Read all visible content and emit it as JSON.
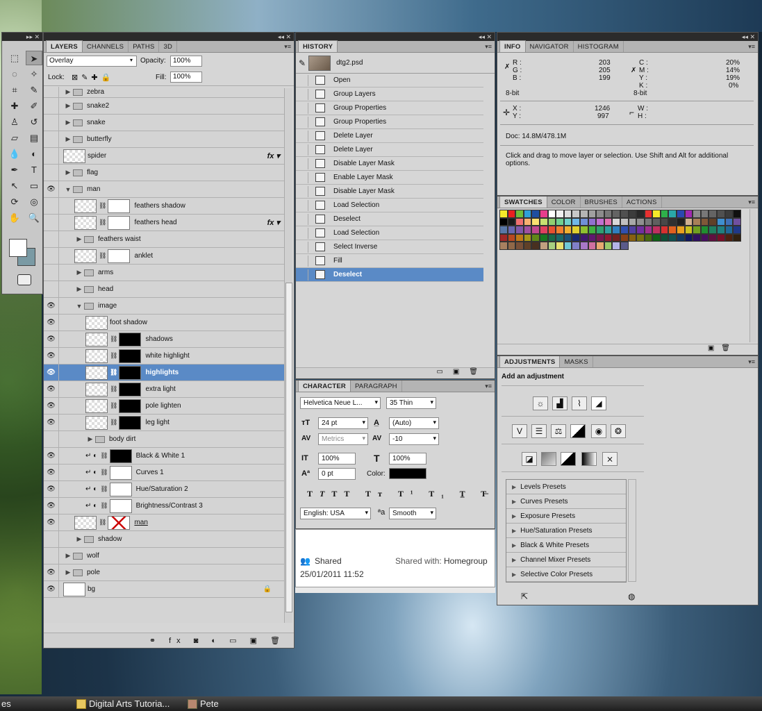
{
  "layers": {
    "tabs": [
      "LAYERS",
      "CHANNELS",
      "PATHS",
      "3D"
    ],
    "blend_mode": "Overlay",
    "opacity_label": "Opacity:",
    "opacity": "100%",
    "lock_label": "Lock:",
    "fill_label": "Fill:",
    "fill": "100%",
    "rows": [
      {
        "name": "zebra",
        "type": "group"
      },
      {
        "name": "snake2",
        "type": "group"
      },
      {
        "name": "snake",
        "type": "group"
      },
      {
        "name": "butterfly",
        "type": "group"
      },
      {
        "name": "spider",
        "type": "layer",
        "fx": "fx"
      },
      {
        "name": "flag",
        "type": "group"
      },
      {
        "name": "man",
        "type": "group-open",
        "eye": true
      },
      {
        "name": "feathers shadow",
        "type": "masked",
        "indent": 1
      },
      {
        "name": "feathers head",
        "type": "masked",
        "indent": 1,
        "fx": "fx"
      },
      {
        "name": "feathers waist",
        "type": "group",
        "indent": 1
      },
      {
        "name": "anklet",
        "type": "masked",
        "indent": 1
      },
      {
        "name": "arms",
        "type": "group",
        "indent": 1
      },
      {
        "name": "head",
        "type": "group",
        "indent": 1
      },
      {
        "name": "image",
        "type": "group-open",
        "indent": 1,
        "eye": true
      },
      {
        "name": "foot shadow",
        "type": "layer",
        "indent": 2,
        "eye": true
      },
      {
        "name": "shadows",
        "type": "masked-black",
        "indent": 2,
        "eye": true
      },
      {
        "name": "white highlight",
        "type": "masked-black",
        "indent": 2,
        "eye": true
      },
      {
        "name": "highlights",
        "type": "masked-black",
        "indent": 2,
        "eye": true,
        "selected": true
      },
      {
        "name": "extra light",
        "type": "masked-black",
        "indent": 2,
        "eye": true
      },
      {
        "name": "pole lighten",
        "type": "masked-black",
        "indent": 2,
        "eye": true
      },
      {
        "name": "leg light",
        "type": "masked-black",
        "indent": 2,
        "eye": true
      },
      {
        "name": "body dirt",
        "type": "group",
        "indent": 2
      },
      {
        "name": "Black & White 1",
        "type": "adjust",
        "indent": 2,
        "eye": true,
        "black": true
      },
      {
        "name": "Curves 1",
        "type": "adjust",
        "indent": 2,
        "eye": true
      },
      {
        "name": "Hue/Saturation 2",
        "type": "adjust",
        "indent": 2,
        "eye": true
      },
      {
        "name": "Brightness/Contrast 3",
        "type": "adjust",
        "indent": 2,
        "eye": true
      },
      {
        "name": "man",
        "type": "smart",
        "indent": 1,
        "eye": true
      },
      {
        "name": "shadow",
        "type": "group",
        "indent": 1
      },
      {
        "name": "wolf",
        "type": "group"
      },
      {
        "name": "pole",
        "type": "group",
        "eye": true
      },
      {
        "name": "bg",
        "type": "bg",
        "eye": true
      }
    ]
  },
  "history": {
    "tab": "HISTORY",
    "snapshot": "dtg2.psd",
    "steps": [
      "Open",
      "Group Layers",
      "Group Properties",
      "Group Properties",
      "Delete Layer",
      "Delete Layer",
      "Disable Layer Mask",
      "Enable Layer Mask",
      "Disable Layer Mask",
      "Load Selection",
      "Deselect",
      "Load Selection",
      "Select Inverse",
      "Fill",
      "Deselect"
    ],
    "selected_index": 14
  },
  "character": {
    "tabs": [
      "CHARACTER",
      "PARAGRAPH"
    ],
    "font_family": "Helvetica Neue L...",
    "font_style": "35 Thin",
    "size": "24 pt",
    "leading": "(Auto)",
    "kerning": "Metrics",
    "tracking": "-10",
    "vscale": "100%",
    "hscale": "100%",
    "baseline": "0 pt",
    "color_label": "Color:",
    "language": "English: USA",
    "aa_label": "a",
    "antialias": "Smooth"
  },
  "explorer": {
    "shared": "Shared",
    "shared_with_label": "Shared with:",
    "shared_with": "Homegroup",
    "date": "25/01/2011 11:52"
  },
  "info": {
    "tabs": [
      "INFO",
      "NAVIGATOR",
      "HISTOGRAM"
    ],
    "r_label": "R :",
    "r": "203",
    "g_label": "G :",
    "g": "205",
    "b_label": "B :",
    "b": "199",
    "c_label": "C :",
    "c": "20%",
    "m_label": "M :",
    "m": "14%",
    "y_label": "Y :",
    "y": "19%",
    "k_label": "K :",
    "k": "0%",
    "bit_left": "8-bit",
    "bit_right": "8-bit",
    "x_label": "X :",
    "x": "1246",
    "y2_label": "Y :",
    "y2": "997",
    "w_label": "W :",
    "h_label": "H :",
    "doc": "Doc: 14.8M/478.1M",
    "hint": "Click and drag to move layer or selection.  Use Shift and Alt for additional options."
  },
  "swatches": {
    "tabs": [
      "SWATCHES",
      "COLOR",
      "BRUSHES",
      "ACTIONS"
    ],
    "colors": [
      "#f5e92a",
      "#ea2020",
      "#6fbd3a",
      "#2ea0d8",
      "#1e4fa0",
      "#e83d8c",
      "#ffffff",
      "#f0f0f0",
      "#dcdcdc",
      "#c8c8c8",
      "#b4b4b4",
      "#a0a0a0",
      "#8c8c8c",
      "#787878",
      "#646464",
      "#505050",
      "#3c3c3c",
      "#282828",
      "#e83030",
      "#f5e92a",
      "#2eb04a",
      "#2aa8a8",
      "#2a48b0",
      "#a02ab0",
      "#8c8c8c",
      "#787878",
      "#646464",
      "#505050",
      "#3c3c3c",
      "#101010",
      "#000000",
      "#1a1a1a",
      "#f07070",
      "#f8b070",
      "#f8e070",
      "#c8e070",
      "#90d070",
      "#70d090",
      "#70d0c8",
      "#70b8e8",
      "#7090d8",
      "#9070d0",
      "#c070d0",
      "#e070b0",
      "#d8d8d8",
      "#c0c0c0",
      "#a8a8a8",
      "#909090",
      "#787878",
      "#606060",
      "#484848",
      "#303030",
      "#202020",
      "#d0b090",
      "#a88058",
      "#805838",
      "#604028",
      "#3f8fcf",
      "#4070b8",
      "#7050a0",
      "#5a78a8",
      "#6868b0",
      "#8058a8",
      "#a050a0",
      "#c04890",
      "#e04060",
      "#e85030",
      "#f08030",
      "#f0b030",
      "#e0d030",
      "#90c030",
      "#40b040",
      "#30a070",
      "#30a0a0",
      "#3080c0",
      "#3050b0",
      "#5040a0",
      "#7030a0",
      "#a03090",
      "#c03060",
      "#d83030",
      "#e06020",
      "#e8a020",
      "#c8c020",
      "#70a020",
      "#209030",
      "#208060",
      "#208080",
      "#206898",
      "#203888",
      "#a02828",
      "#b84820",
      "#c07818",
      "#a89818",
      "#608818",
      "#187820",
      "#186848",
      "#186868",
      "#185078",
      "#182870",
      "#401870",
      "#601870",
      "#781850",
      "#901830",
      "#702020",
      "#884018",
      "#886010",
      "#787010",
      "#486810",
      "#106018",
      "#105038",
      "#105050",
      "#103860",
      "#101860",
      "#301060",
      "#481060",
      "#601040",
      "#781028",
      "#502010",
      "#302010",
      "#a88060",
      "#906848",
      "#785038",
      "#604028",
      "#483020",
      "#c0a080",
      "#a8d080",
      "#e8e070",
      "#70c8d8",
      "#8080c8",
      "#a878c8",
      "#d070a0",
      "#e8a870",
      "#9ac86a",
      "#b4b4e8",
      "#5a5a8a"
    ]
  },
  "adjust": {
    "tabs": [
      "ADJUSTMENTS",
      "MASKS"
    ],
    "heading": "Add an adjustment",
    "presets": [
      "Levels Presets",
      "Curves Presets",
      "Exposure Presets",
      "Hue/Saturation Presets",
      "Black & White Presets",
      "Channel Mixer Presets",
      "Selective Color Presets"
    ]
  },
  "taskbar": {
    "left_stub": "es",
    "item1": "Digital Arts Tutoria...",
    "item2": "Pete"
  }
}
